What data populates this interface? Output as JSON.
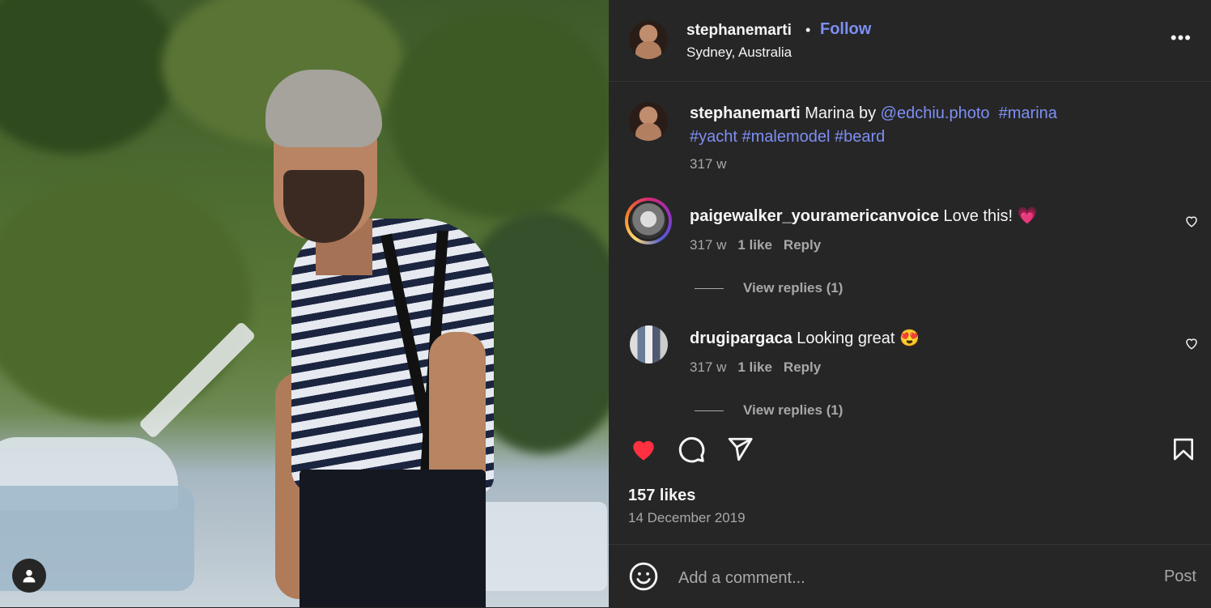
{
  "post": {
    "username": "stephanemarti",
    "separator": "•",
    "follow_label": "Follow",
    "location": "Sydney, Australia",
    "more_label": "•••",
    "caption": {
      "username": "stephanemarti",
      "text": " Marina by ",
      "mention": "@edchiu.photo",
      "hashtags_line1": "#marina",
      "hashtags_line2": [
        "#yacht",
        "#malemodel",
        "#beard"
      ],
      "age": "317 w"
    },
    "comments": [
      {
        "username": "paigewalker_youramericanvoice",
        "text": " Love this! ",
        "emoji": "💗",
        "age": "317 w",
        "likes": "1 like",
        "reply_label": "Reply",
        "view_replies": "View replies (1)"
      },
      {
        "username": "drugipargaca",
        "text": " Looking great ",
        "emoji": "😍",
        "age": "317 w",
        "likes": "1 like",
        "reply_label": "Reply",
        "view_replies": "View replies (1)"
      }
    ],
    "likes_count": "157 likes",
    "date": "14 December 2019",
    "composer": {
      "placeholder": "Add a comment...",
      "post_label": "Post"
    },
    "colors": {
      "background": "#262626",
      "link": "#7d8ff5",
      "like_red": "#ff3040",
      "muted": "#a8a8a8"
    },
    "icons": [
      "heart-icon",
      "comment-icon",
      "share-icon",
      "bookmark-icon",
      "emoji-icon",
      "user-icon",
      "more-icon"
    ]
  }
}
